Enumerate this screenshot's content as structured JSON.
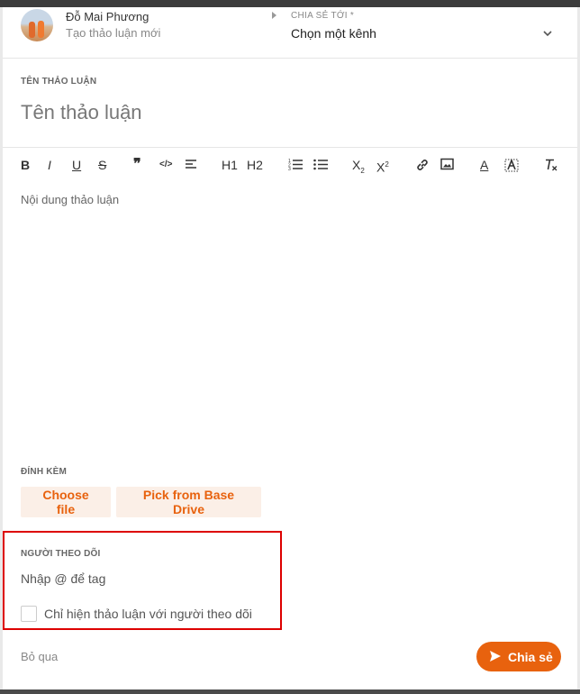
{
  "header": {
    "user_name": "Đỗ Mai Phương",
    "subtitle": "Tạo thảo luận mới",
    "share_label": "CHIA SẺ TỚI *",
    "channel_value": "Chọn một kênh"
  },
  "title_section": {
    "label": "TÊN THẢO LUẬN",
    "placeholder": "Tên thảo luận",
    "value": ""
  },
  "toolbar": {
    "bold": "B",
    "italic": "I",
    "underline": "U",
    "strike": "S",
    "quote": "❞",
    "code": "</>",
    "h1": "H1",
    "h2": "H2",
    "subscript": "X",
    "superscript": "X",
    "text_color": "A"
  },
  "content": {
    "placeholder": "Nội dung thảo luận",
    "value": ""
  },
  "attachments": {
    "label": "ĐÍNH KÈM",
    "choose_file": "Choose file",
    "pick_base_drive": "Pick from Base Drive"
  },
  "followers": {
    "label": "NGƯỜI THEO DÕI",
    "input_placeholder": "Nhập @ để tag",
    "checkbox_label": "Chỉ hiện thảo luận với người theo dõi",
    "checkbox_checked": false
  },
  "footer": {
    "skip": "Bỏ qua",
    "share": "Chia sẻ"
  },
  "colors": {
    "accent": "#e8620e",
    "accent_light": "#fbefe7",
    "highlight_border": "#dd0000"
  }
}
